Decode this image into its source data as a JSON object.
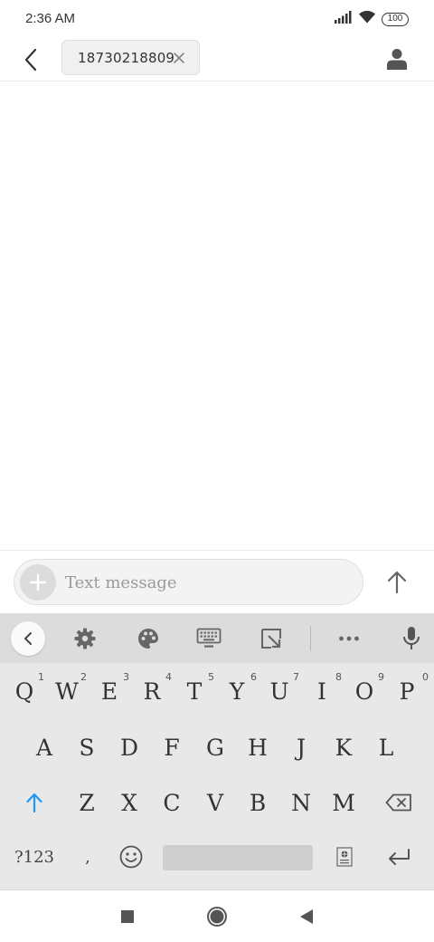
{
  "status_bar": {
    "time": "2:36 AM",
    "battery": "100",
    "icons": [
      "signal-icon",
      "wifi-icon",
      "battery-icon"
    ]
  },
  "header": {
    "back_icon": "chevron-left-icon",
    "recipient": "18730218809",
    "remove_icon": "close-icon",
    "contact_icon": "person-icon"
  },
  "compose": {
    "placeholder": "Text message",
    "add_icon": "plus-icon",
    "send_icon": "arrow-up-icon"
  },
  "keyboard": {
    "toolbar": [
      "chevron-left-icon",
      "gear-icon",
      "palette-icon",
      "keyboard-icon",
      "resize-icon",
      "more-icon",
      "microphone-icon"
    ],
    "row1": [
      {
        "key": "Q",
        "hint": "1"
      },
      {
        "key": "W",
        "hint": "2"
      },
      {
        "key": "E",
        "hint": "3"
      },
      {
        "key": "R",
        "hint": "4"
      },
      {
        "key": "T",
        "hint": "5"
      },
      {
        "key": "Y",
        "hint": "6"
      },
      {
        "key": "U",
        "hint": "7"
      },
      {
        "key": "I",
        "hint": "8"
      },
      {
        "key": "O",
        "hint": "9"
      },
      {
        "key": "P",
        "hint": "0"
      }
    ],
    "row2": [
      "A",
      "S",
      "D",
      "F",
      "G",
      "H",
      "J",
      "K",
      "L"
    ],
    "row3": [
      "Z",
      "X",
      "C",
      "V",
      "B",
      "N",
      "M"
    ],
    "symbols_label": "?123",
    "comma": ",",
    "shift_icon": "shift-arrow-icon",
    "backspace_icon": "backspace-icon",
    "emoji_icon": "emoji-icon",
    "sticker_icon": "sticker-icon",
    "enter_icon": "enter-icon",
    "accent_color": "#2196f3"
  },
  "nav_bar": {
    "icons": [
      "recents-square-icon",
      "home-circle-icon",
      "back-triangle-icon"
    ]
  }
}
